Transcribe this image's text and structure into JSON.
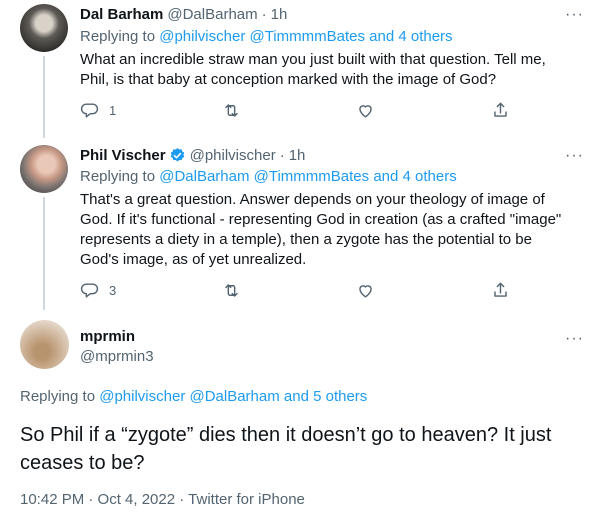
{
  "colors": {
    "link": "#1d9bf0",
    "secondary": "#536471",
    "text": "#0f1419",
    "verified": "#1d9bf0"
  },
  "tweets": [
    {
      "name": "Dal Barham",
      "handle": "@DalBarham",
      "time": "1h",
      "reply_prefix": "Replying to ",
      "reply_handles": "@philvischer @TimmmmBates and 4 others",
      "text": "What an incredible straw man you just built with that question. Tell me, Phil, is that baby at conception marked with the image of God?",
      "reply_count": "1",
      "retweet_count": "",
      "like_count": ""
    },
    {
      "name": "Phil Vischer",
      "handle": "@philvischer",
      "time": "1h",
      "verified": true,
      "reply_prefix": "Replying to ",
      "reply_handles": "@DalBarham @TimmmmBates and 4 others",
      "text": "That's a great question.  Answer depends on your theology of image of God.  If it's functional - representing God in creation (as a crafted \"image\" represents a diety in a temple), then a zygote has the potential to be God's image, as of yet unrealized.",
      "reply_count": "3",
      "retweet_count": "",
      "like_count": ""
    }
  ],
  "main_tweet": {
    "name": "mprmin",
    "handle": "@mprmin3",
    "reply_prefix": "Replying to ",
    "reply_handles": "@philvischer @DalBarham and 5 others",
    "text": "So Phil if a “zygote” dies then it doesn’t go to heaven? It just ceases to be?",
    "timestamp": "10:42 PM · Oct 4, 2022 · ",
    "source": "Twitter for iPhone"
  },
  "ui": {
    "more_glyph": "···",
    "dot_sep": "·"
  },
  "icons": [
    "reply-icon",
    "retweet-icon",
    "like-icon",
    "share-icon",
    "verified-badge-icon",
    "more-icon"
  ]
}
